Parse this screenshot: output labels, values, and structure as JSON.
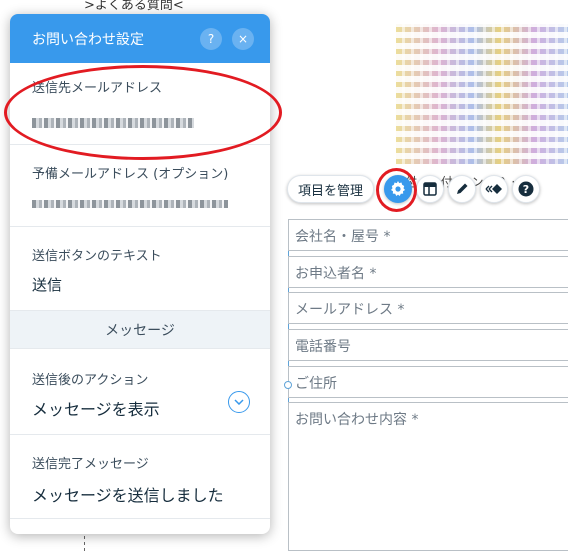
{
  "background": {
    "top_link": ">よくある質問<",
    "blur_caption": "付·受·付·…ン·00 ·",
    "toolbar": {
      "manage_label": "項目を管理",
      "help_glyph": "?",
      "icons": [
        "gear-icon",
        "layout-icon",
        "pen-icon",
        "animation-icon",
        "help-icon"
      ]
    },
    "form_fields": [
      "会社名・屋号 *",
      "お申込者名 *",
      "メールアドレス *",
      "電話番号",
      "ご住所",
      "お問い合わせ内容 *"
    ]
  },
  "panel": {
    "title": "お問い合わせ設定",
    "help_glyph": "?",
    "close_glyph": "×",
    "sections": {
      "recipient_email": {
        "label": "送信先メールアドレス"
      },
      "backup_email": {
        "label": "予備メールアドレス (オプション)"
      },
      "button_text": {
        "label": "送信ボタンのテキスト",
        "value": "送信"
      },
      "message_divider": "メッセージ",
      "after_action": {
        "label": "送信後のアクション",
        "value": "メッセージを表示"
      },
      "complete_message": {
        "label": "送信完了メッセージ",
        "value": "メッセージを送信しました"
      }
    }
  },
  "colors": {
    "accent": "#3899ec",
    "annotation": "#e21b22"
  }
}
